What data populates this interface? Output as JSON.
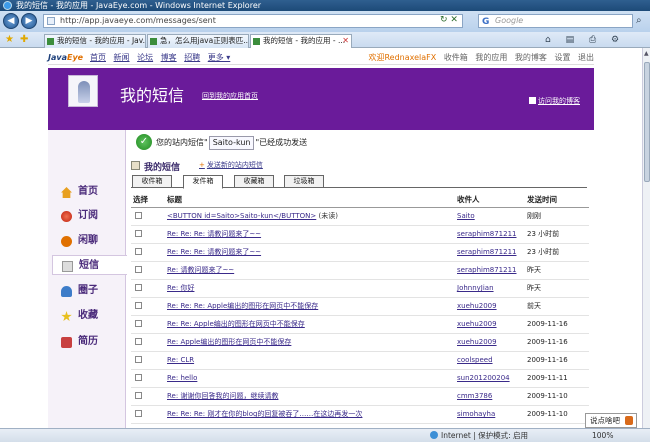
{
  "window": {
    "title": "我的短信 - 我的应用 - JavaEye.com - Windows Internet Explorer"
  },
  "address": {
    "url": "http://app.javaeye.com/messages/sent",
    "search_placeholder": "Google",
    "search_engine_icon": "G"
  },
  "browser_tabs": [
    {
      "label": "我的短信 - 我的应用 - Jav..."
    },
    {
      "label": "急，怎么用java正则表匹..."
    },
    {
      "label": "我的短信 - 我的应用 - ..."
    }
  ],
  "topnav": {
    "logo_main": "Java",
    "logo_accent": "Eye",
    "links": [
      "首页",
      "新闻",
      "论坛",
      "博客",
      "招聘",
      "更多 ▾"
    ],
    "welcome": "欢迎RednaxelaFX",
    "right_links": [
      "收件箱",
      "我的应用",
      "我的博客",
      "设置",
      "退出"
    ]
  },
  "banner": {
    "title": "我的短信",
    "back_link": "回到我的应用首页",
    "right_link": "访问我的博客"
  },
  "sidebar": [
    {
      "label": "首页",
      "icon": "home-icon",
      "color": "#e8a020"
    },
    {
      "label": "订阅",
      "icon": "subscribe-icon",
      "color": "#d9402a"
    },
    {
      "label": "闲聊",
      "icon": "chat-icon",
      "color": "#e07000"
    },
    {
      "label": "短信",
      "icon": "message-icon",
      "color": "#c0c0c0"
    },
    {
      "label": "圈子",
      "icon": "group-icon",
      "color": "#3d7cc9"
    },
    {
      "label": "收藏",
      "icon": "favorite-icon",
      "color": "#e8c020"
    },
    {
      "label": "简历",
      "icon": "resume-icon",
      "color": "#c84040"
    }
  ],
  "notice": {
    "prefix": "您的站内短信\"",
    "recipient": "Saito-kun",
    "suffix": "\"已经成功发送"
  },
  "section": {
    "title": "我的短信",
    "new_link_plus": "+",
    "new_link": "发送新的站内短信"
  },
  "mail_tabs": [
    "收件箱",
    "发件箱",
    "收藏箱",
    "垃圾箱"
  ],
  "active_tab": 1,
  "table": {
    "headers": [
      "选择",
      "标题",
      "收件人",
      "发送时间"
    ],
    "rows": [
      {
        "title": "<BUTTON id=Saito>Saito-kun</BUTTON>",
        "status": "(未读)",
        "to": "Saito",
        "time": "刚刚"
      },
      {
        "title": "Re: Re: Re: 请教问题来了~~",
        "status": "",
        "to": "seraphim871211",
        "time": "23 小时前"
      },
      {
        "title": "Re: Re: Re: 请教问题来了~~",
        "status": "",
        "to": "seraphim871211",
        "time": "23 小时前"
      },
      {
        "title": "Re: 请教问题来了~~",
        "status": "",
        "to": "seraphim871211",
        "time": "昨天"
      },
      {
        "title": "Re: 你好",
        "status": "",
        "to": "JohnnyJian",
        "time": "昨天"
      },
      {
        "title": "Re: Re: Re: Apple编出的图形在网页中不能保存",
        "status": "",
        "to": "xuehu2009",
        "time": "前天"
      },
      {
        "title": "Re: Re: Apple编出的图形在网页中不能保存",
        "status": "",
        "to": "xuehu2009",
        "time": "2009-11-16"
      },
      {
        "title": "Re: Apple编出的图形在网页中不能保存",
        "status": "",
        "to": "xuehu2009",
        "time": "2009-11-16"
      },
      {
        "title": "Re: CLR",
        "status": "",
        "to": "coolspeed",
        "time": "2009-11-16"
      },
      {
        "title": "Re: hello",
        "status": "",
        "to": "sun201200204",
        "time": "2009-11-11"
      },
      {
        "title": "Re: 谢谢你回答我的问题，继续请教",
        "status": "",
        "to": "cmm3786",
        "time": "2009-11-10"
      },
      {
        "title": "Re: Re: Re: 刚才在你的blog的回复被吞了……在这边再发一次",
        "status": "",
        "to": "simohayha",
        "time": "2009-11-10"
      }
    ]
  },
  "statusbar": {
    "zone": "Internet | 保护模式: 启用",
    "zoom": "100%"
  },
  "speech_widget": {
    "label": "说点啥吧"
  }
}
